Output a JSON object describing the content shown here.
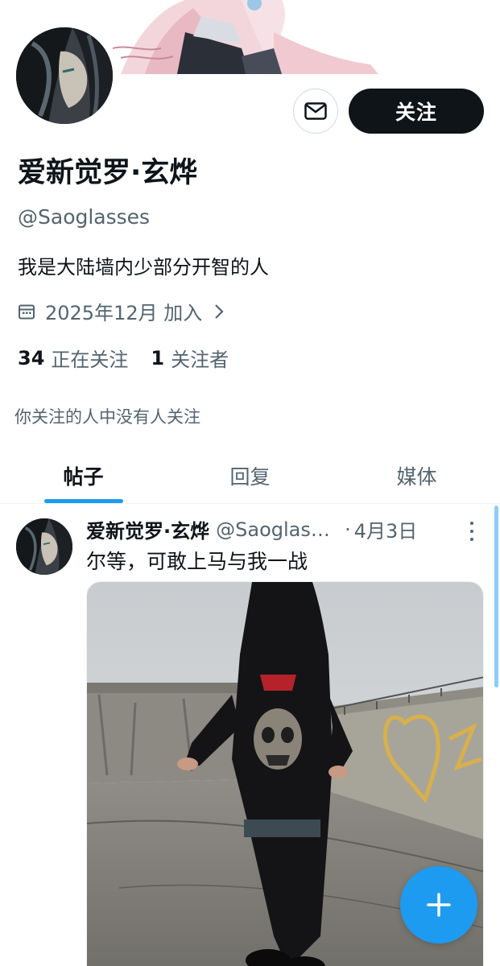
{
  "profile": {
    "display_name": "爱新觉罗·玄烨",
    "handle": "@Saoglasses",
    "bio": "我是大陆墙内少部分开智的人",
    "joined": "2025年12月 加入",
    "following_count": "34",
    "following_label": "正在关注",
    "followers_count": "1",
    "followers_label": "关注者",
    "followers_you_know": "你关注的人中没有人关注"
  },
  "actions": {
    "follow_label": "关注",
    "message_icon": "mail-icon"
  },
  "tabs": [
    {
      "label": "帖子",
      "active": true
    },
    {
      "label": "回复",
      "active": false
    },
    {
      "label": "媒体",
      "active": false
    }
  ],
  "post": {
    "author_name": "爱新觉罗·玄烨",
    "author_handle": "@Saoglasses",
    "separator": "·",
    "date": "4月3日",
    "text": "尔等，可敢上马与我一战"
  },
  "colors": {
    "accent": "#1d9bf0",
    "text_primary": "#0f1419",
    "text_secondary": "#536471",
    "button_dark": "#0f1419"
  },
  "icons": {
    "calendar": "calendar-icon",
    "chevron": "chevron-right-icon",
    "more": "more-vertical-icon",
    "compose": "plus-icon"
  }
}
